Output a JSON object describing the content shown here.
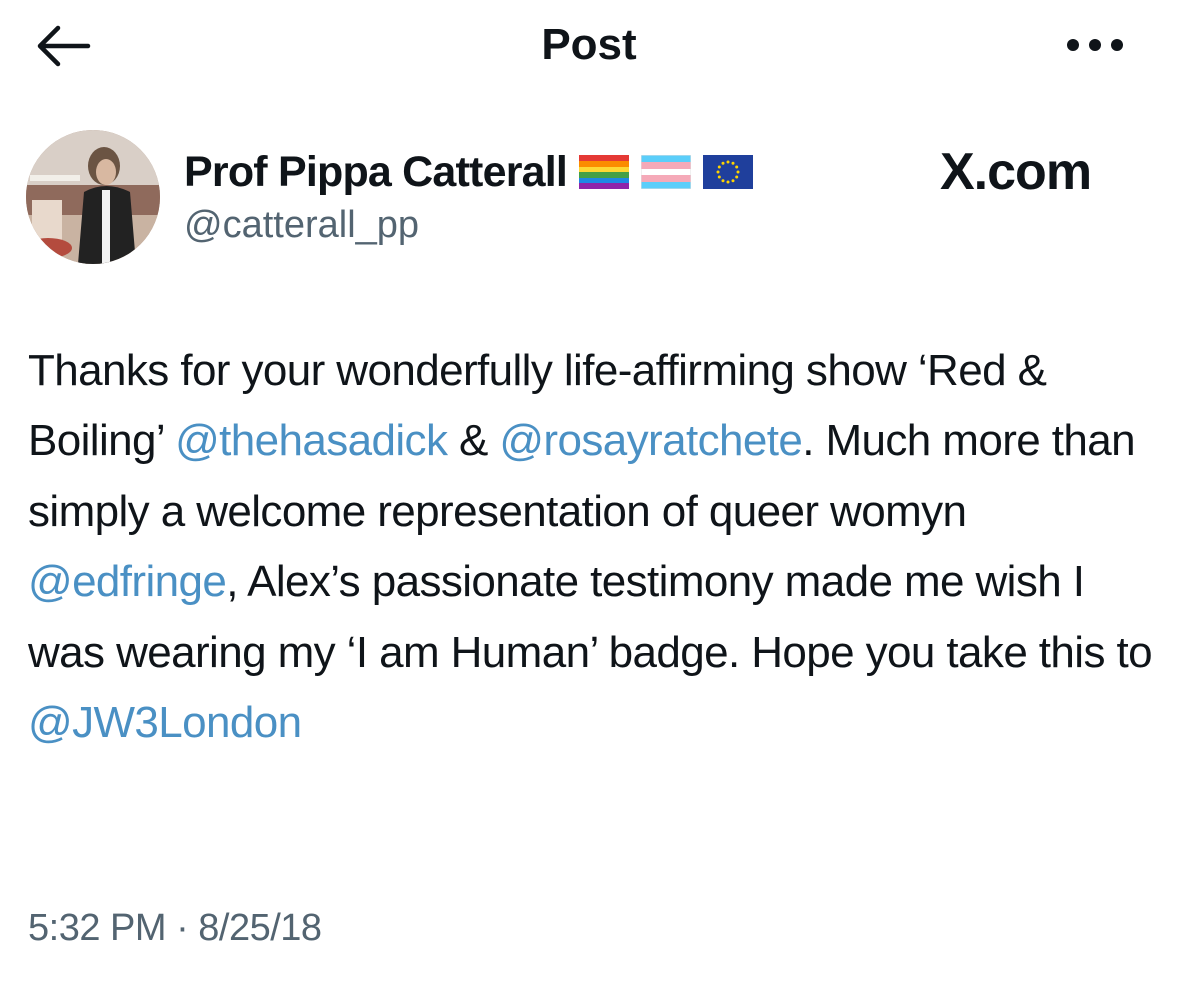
{
  "header": {
    "title": "Post",
    "back_icon": "arrow-left-icon",
    "more_icon": "more-horizontal-icon"
  },
  "author": {
    "display_name": "Prof Pippa Catterall",
    "handle": "@catterall_pp",
    "avatar_icon": "profile-photo",
    "flags": [
      "rainbow-flag-emoji",
      "transgender-flag-emoji",
      "eu-flag-emoji"
    ]
  },
  "watermark": "X.com",
  "tweet": {
    "segments": [
      {
        "type": "text",
        "text": "Thanks for your wonderfully life-affirming show ‘Red & Boiling’ "
      },
      {
        "type": "mention",
        "text": "@thehasadick"
      },
      {
        "type": "text",
        "text": " & "
      },
      {
        "type": "mention",
        "text": "@rosayratchete"
      },
      {
        "type": "text",
        "text": ". Much more than simply a welcome representation of queer womyn "
      },
      {
        "type": "mention",
        "text": "@edfringe"
      },
      {
        "type": "text",
        "text": ", Alex’s passionate testimony made me wish I was wearing my ‘I am Human’ badge. Hope you take this to "
      },
      {
        "type": "mention",
        "text": "@JW3London"
      }
    ]
  },
  "timestamp": "5:32 PM · 8/25/18",
  "colors": {
    "text": "#0f1419",
    "secondary": "#536471",
    "mention": "#4a90c4",
    "background": "#ffffff"
  }
}
